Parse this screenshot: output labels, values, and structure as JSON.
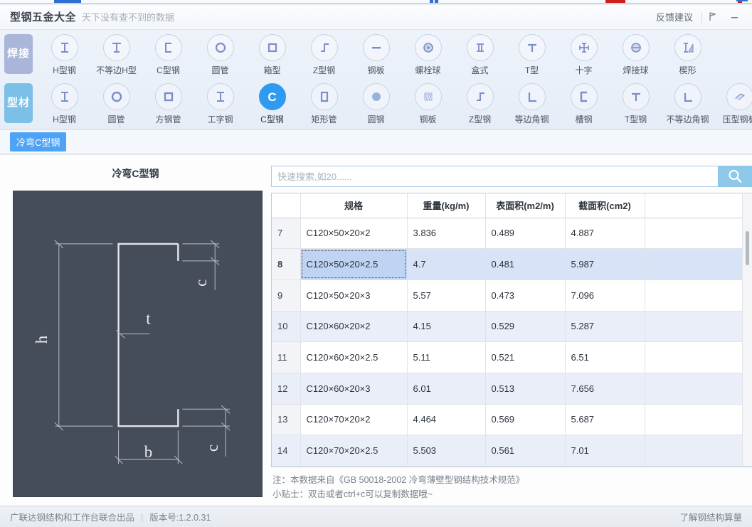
{
  "titlebar": {
    "app_title": "型钢五金大全",
    "subtitle": "天下没有查不到的数据",
    "feedback_label": "反馈建议",
    "pin_icon": "pin-icon",
    "minimize_icon": "minimize-icon"
  },
  "toolbar": {
    "rows": [
      {
        "category": "焊接",
        "active": false,
        "items": [
          {
            "label": "H型钢",
            "icon": "h-beam-icon",
            "selected": false
          },
          {
            "label": "不等边H型",
            "icon": "unequal-h-beam-icon",
            "selected": false
          },
          {
            "label": "C型钢",
            "icon": "c-channel-icon",
            "selected": false
          },
          {
            "label": "圆管",
            "icon": "round-pipe-icon",
            "selected": false
          },
          {
            "label": "箱型",
            "icon": "box-section-icon",
            "selected": false
          },
          {
            "label": "Z型钢",
            "icon": "z-section-icon",
            "selected": false
          },
          {
            "label": "钢板",
            "icon": "steel-plate-icon",
            "selected": false
          },
          {
            "label": "螺栓球",
            "icon": "bolt-ball-icon",
            "selected": false
          },
          {
            "label": "盒式",
            "icon": "box-joint-icon",
            "selected": false
          },
          {
            "label": "T型",
            "icon": "t-section-icon",
            "selected": false
          },
          {
            "label": "十字",
            "icon": "cross-section-icon",
            "selected": false
          },
          {
            "label": "焊接球",
            "icon": "welded-ball-icon",
            "selected": false
          },
          {
            "label": "楔形",
            "icon": "wedge-icon",
            "selected": false
          }
        ]
      },
      {
        "category": "型材",
        "active": true,
        "items": [
          {
            "label": "H型钢",
            "icon": "h-beam-icon",
            "selected": false
          },
          {
            "label": "圆管",
            "icon": "round-pipe-icon",
            "selected": false
          },
          {
            "label": "方钢管",
            "icon": "square-pipe-icon",
            "selected": false
          },
          {
            "label": "工字钢",
            "icon": "i-beam-icon",
            "selected": false
          },
          {
            "label": "C型钢",
            "icon": "c-channel-icon",
            "selected": true
          },
          {
            "label": "矩形管",
            "icon": "rect-pipe-icon",
            "selected": false
          },
          {
            "label": "圆钢",
            "icon": "round-bar-icon",
            "selected": false
          },
          {
            "label": "钢板",
            "icon": "checker-plate-icon",
            "selected": false
          },
          {
            "label": "Z型钢",
            "icon": "z-section-icon",
            "selected": false
          },
          {
            "label": "等边角钢",
            "icon": "equal-angle-icon",
            "selected": false
          },
          {
            "label": "槽钢",
            "icon": "channel-icon",
            "selected": false
          },
          {
            "label": "T型钢",
            "icon": "t-section-icon",
            "selected": false
          },
          {
            "label": "不等边角钢",
            "icon": "unequal-angle-icon",
            "selected": false
          },
          {
            "label": "压型钢板",
            "icon": "profiled-plate-icon",
            "selected": false
          }
        ]
      }
    ]
  },
  "tabstrip": {
    "active_tab": "冷弯C型钢"
  },
  "diagram": {
    "title": "冷弯C型钢",
    "labels": {
      "height": "h",
      "width": "b",
      "lip_top": "c",
      "lip_bottom": "c",
      "thickness": "t"
    },
    "background_color": "#454d5a",
    "line_color": "#e8eaee"
  },
  "search": {
    "placeholder": "快速搜索,如20......",
    "value": "",
    "button_icon": "search-icon",
    "button_color": "#8ec9ea"
  },
  "table": {
    "columns": [
      "",
      "规格",
      "重量(kg/m)",
      "表面积(m2/m)",
      "截面积(cm2)"
    ],
    "rows": [
      {
        "idx": "7",
        "spec": "C120×50×20×2",
        "weight": "3.836",
        "surface": "0.489",
        "section": "4.887",
        "selected": false
      },
      {
        "idx": "8",
        "spec": "C120×50×20×2.5",
        "weight": "4.7",
        "surface": "0.481",
        "section": "5.987",
        "selected": true
      },
      {
        "idx": "9",
        "spec": "C120×50×20×3",
        "weight": "5.57",
        "surface": "0.473",
        "section": "7.096",
        "selected": false
      },
      {
        "idx": "10",
        "spec": "C120×60×20×2",
        "weight": "4.15",
        "surface": "0.529",
        "section": "5.287",
        "selected": false
      },
      {
        "idx": "11",
        "spec": "C120×60×20×2.5",
        "weight": "5.11",
        "surface": "0.521",
        "section": "6.51",
        "selected": false
      },
      {
        "idx": "12",
        "spec": "C120×60×20×3",
        "weight": "6.01",
        "surface": "0.513",
        "section": "7.656",
        "selected": false
      },
      {
        "idx": "13",
        "spec": "C120×70×20×2",
        "weight": "4.464",
        "surface": "0.569",
        "section": "5.687",
        "selected": false
      },
      {
        "idx": "14",
        "spec": "C120×70×20×2.5",
        "weight": "5.503",
        "surface": "0.561",
        "section": "7.01",
        "selected": false
      }
    ]
  },
  "notes": {
    "source": "注：本数据来自《GB  50018-2002  冷弯薄壁型钢结构技术规范》",
    "tip": "小贴士：双击或者ctrl+c可以复制数据哦~"
  },
  "statusbar": {
    "producer": "广联达钢结构和工作台联合出品",
    "separator": "|",
    "version": "版本号:1.2.0.31",
    "link": "了解钢结构算量"
  }
}
